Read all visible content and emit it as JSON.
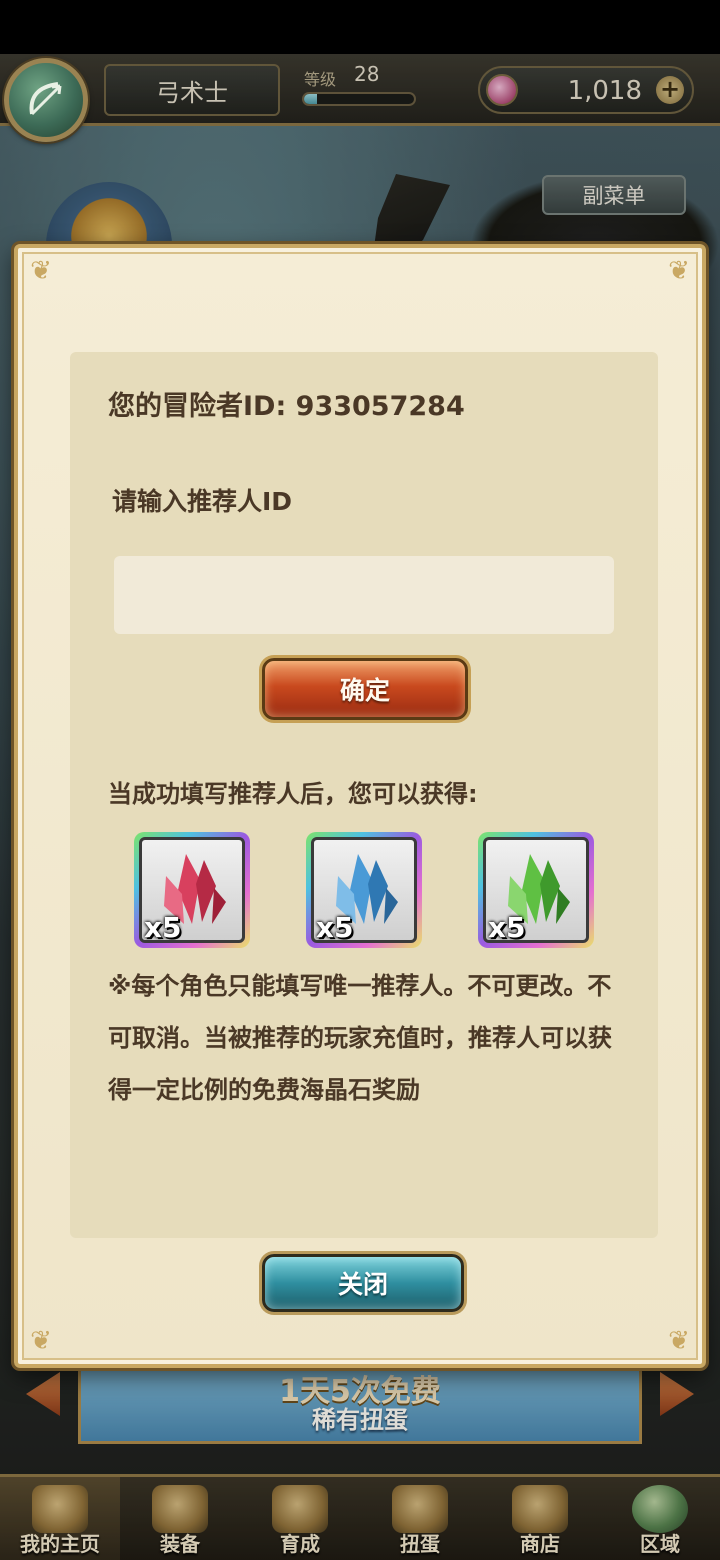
{
  "topbar": {
    "class_name": "弓术士",
    "level_label": "等级",
    "level_value": "28",
    "level_progress": 0.12,
    "gems": "1,018",
    "add_symbol": "+",
    "submenu_label": "副菜单"
  },
  "dialog": {
    "adventurer_id_text": "您的冒险者ID: 933057284",
    "referrer_prompt": "请输入推荐人ID",
    "referrer_input_value": "",
    "confirm_label": "确定",
    "reward_caption": "当成功填写推荐人后，您可以获得:",
    "rewards": [
      {
        "icon": "red-crystal-icon",
        "color": "#c8344f",
        "qty": "x5"
      },
      {
        "icon": "blue-crystal-icon",
        "color": "#3f8fcf",
        "qty": "x5"
      },
      {
        "icon": "green-crystal-icon",
        "color": "#55b83a",
        "qty": "x5"
      }
    ],
    "notice_line1": "※每个角色只能填写唯一推荐人。不可更改。不",
    "notice_line2": "可取消。当被推荐的玩家充值时，推荐人可以获",
    "notice_line3": "得一定比例的免费海晶石奖励",
    "close_label": "关闭"
  },
  "banner": {
    "title": "1天5次免费",
    "subtitle": "稀有扭蛋"
  },
  "bottom_nav": {
    "items": [
      {
        "label": "我的主页",
        "icon": "scroll-icon",
        "active": true
      },
      {
        "label": "装备",
        "icon": "helmet-icon",
        "active": false
      },
      {
        "label": "育成",
        "icon": "sword-icon",
        "active": false
      },
      {
        "label": "扭蛋",
        "icon": "capsule-bell-icon",
        "active": false
      },
      {
        "label": "商店",
        "icon": "money-bag-icon",
        "active": false
      },
      {
        "label": "区域",
        "icon": "globe-icon",
        "active": false
      }
    ]
  },
  "colors": {
    "dialog_bg": "#efe5c9",
    "panel_bg": "#e6dcbb",
    "text_brown": "#4a3826",
    "confirm_red": "#c9491e",
    "close_teal": "#2f8fa0",
    "gold_border": "#c9a863"
  }
}
